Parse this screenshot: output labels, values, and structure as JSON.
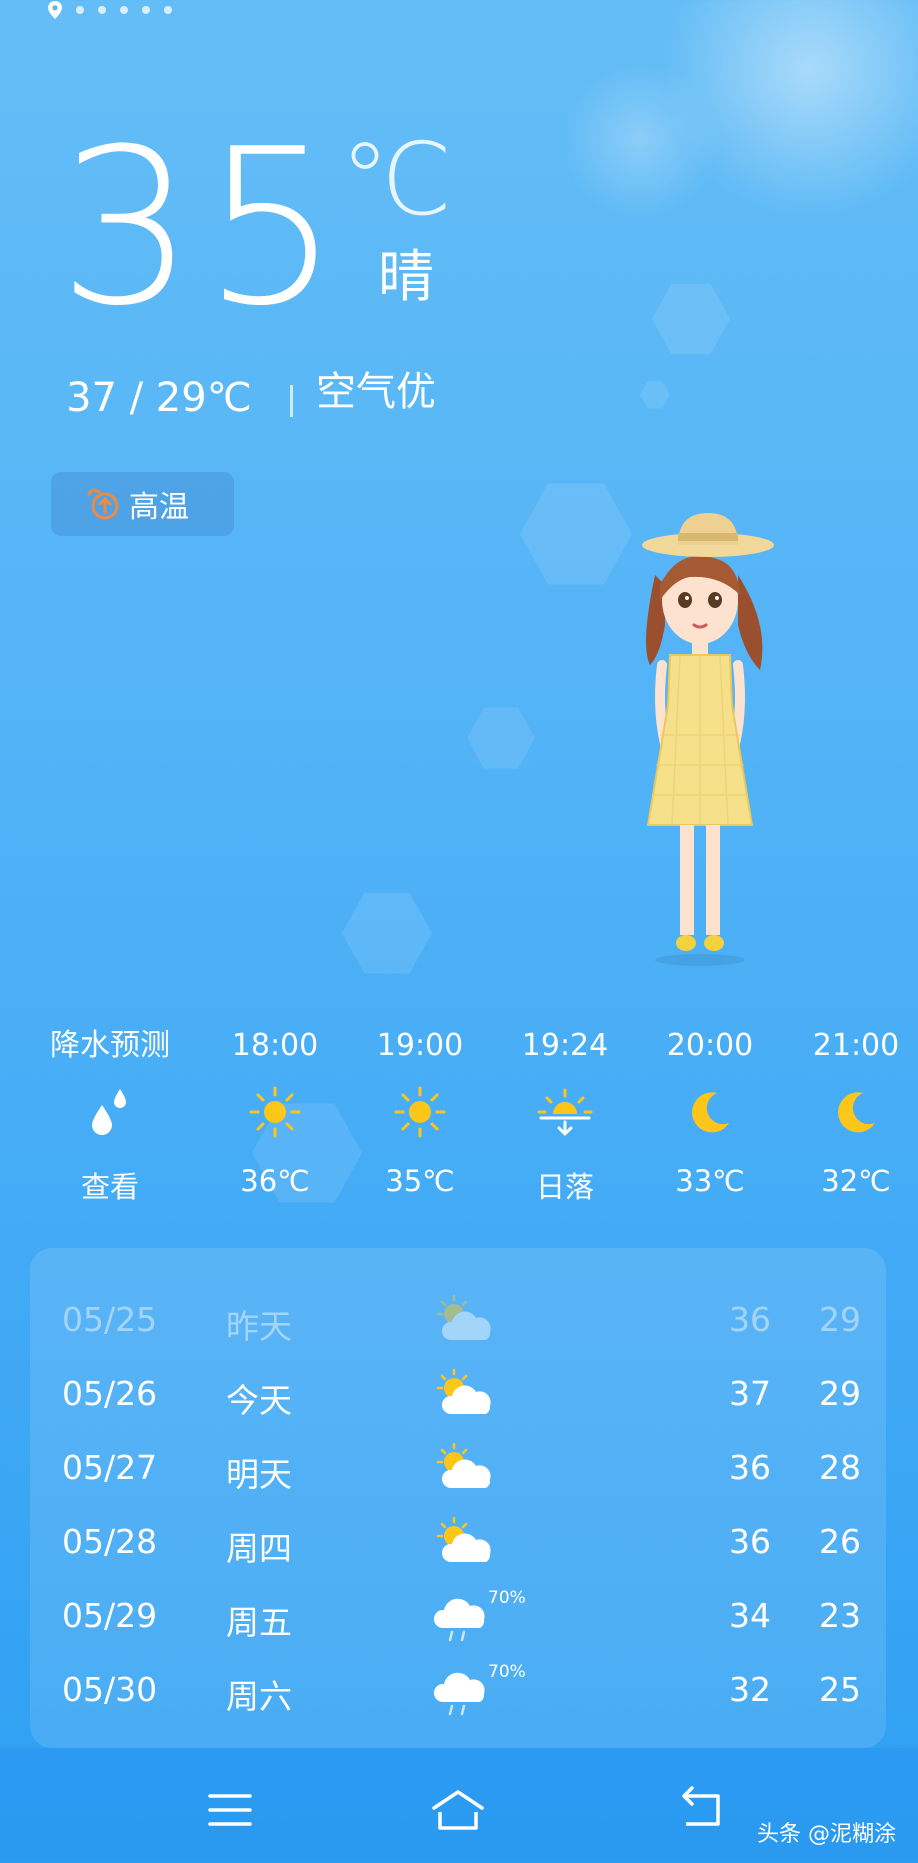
{
  "location_dots": 6,
  "current": {
    "temperature": "35",
    "unit": "℃",
    "condition": "晴",
    "high_low": "37 / 29℃",
    "air_quality": "空气优"
  },
  "alert": {
    "label": "高温",
    "icon": "high-temp-icon",
    "icon_color": "#f08a3c"
  },
  "hourly": [
    {
      "label": "降水预测",
      "icon": "raindrop-icon",
      "value": "查看"
    },
    {
      "label": "18:00",
      "icon": "sun-icon",
      "value": "36℃"
    },
    {
      "label": "19:00",
      "icon": "sun-icon",
      "value": "35℃"
    },
    {
      "label": "19:24",
      "icon": "sunset-icon",
      "value": "日落"
    },
    {
      "label": "20:00",
      "icon": "moon-icon",
      "value": "33℃"
    },
    {
      "label": "21:00",
      "icon": "moon-icon",
      "value": "32℃"
    }
  ],
  "daily": [
    {
      "date": "05/25",
      "day": "昨天",
      "icon": "partly-cloudy-icon",
      "precip": "",
      "high": "36",
      "low": "29"
    },
    {
      "date": "05/26",
      "day": "今天",
      "icon": "partly-cloudy-icon",
      "precip": "",
      "high": "37",
      "low": "29"
    },
    {
      "date": "05/27",
      "day": "明天",
      "icon": "partly-cloudy-icon",
      "precip": "",
      "high": "36",
      "low": "28"
    },
    {
      "date": "05/28",
      "day": "周四",
      "icon": "partly-cloudy-icon",
      "precip": "",
      "high": "36",
      "low": "26"
    },
    {
      "date": "05/29",
      "day": "周五",
      "icon": "rain-icon",
      "precip": "70%",
      "high": "34",
      "low": "23"
    },
    {
      "date": "05/30",
      "day": "周六",
      "icon": "rain-icon",
      "precip": "70%",
      "high": "32",
      "low": "25"
    }
  ],
  "nav": {
    "menu_icon": "menu-icon",
    "home_icon": "home-icon",
    "back_icon": "back-icon"
  },
  "watermark": "头条 @泥糊涂",
  "colors": {
    "sun": "#ffc61a",
    "moon": "#ffc61a",
    "accent_alert": "#f08a3c"
  }
}
